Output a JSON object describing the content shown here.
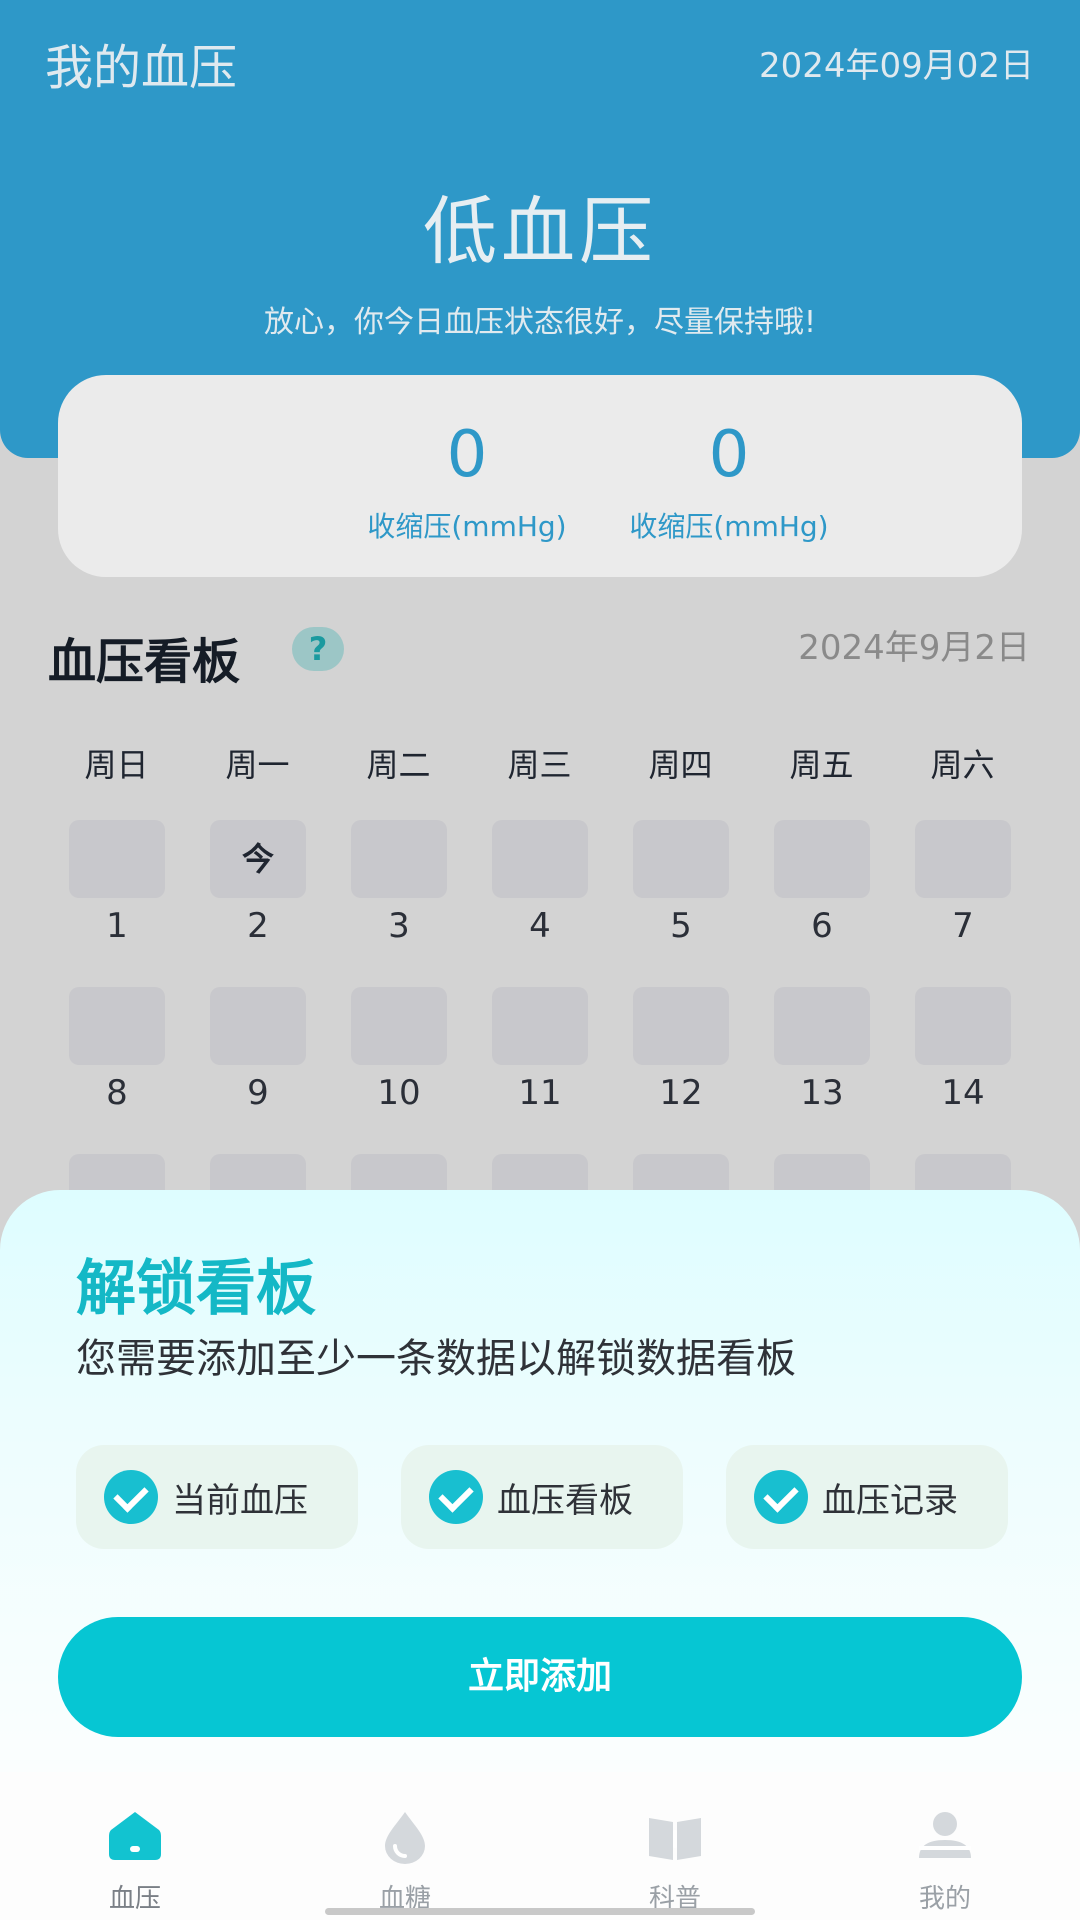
{
  "header": {
    "app_title": "我的血压",
    "date": "2024年09月02日",
    "status_title": "低血压",
    "status_message": "放心，你今日血压状态很好，尽量保持哦!"
  },
  "reading": {
    "systolic_value": "0",
    "systolic_label": "收缩压(mmHg)",
    "diastolic_value": "0",
    "diastolic_label": "收缩压(mmHg)",
    "accent_color": "#2e98c8"
  },
  "board": {
    "title": "血压看板",
    "help_symbol": "?",
    "date": "2024年9月2日",
    "weekdays": [
      "周日",
      "周一",
      "周二",
      "周三",
      "周四",
      "周五",
      "周六"
    ],
    "today_marker": "今",
    "week1": [
      "1",
      "2",
      "3",
      "4",
      "5",
      "6",
      "7"
    ],
    "week2": [
      "8",
      "9",
      "10",
      "11",
      "12",
      "13",
      "14"
    ]
  },
  "unlock": {
    "title": "解锁看板",
    "description": "您需要添加至少一条数据以解锁数据看板",
    "features": [
      "当前血压",
      "血压看板",
      "血压记录"
    ],
    "button_label": "立即添加",
    "accent_color": "#06c6d3"
  },
  "nav": {
    "items": [
      {
        "label": "血压",
        "icon": "home-icon"
      },
      {
        "label": "血糖",
        "icon": "drop-icon"
      },
      {
        "label": "科普",
        "icon": "book-icon"
      },
      {
        "label": "我的",
        "icon": "person-icon"
      }
    ]
  }
}
